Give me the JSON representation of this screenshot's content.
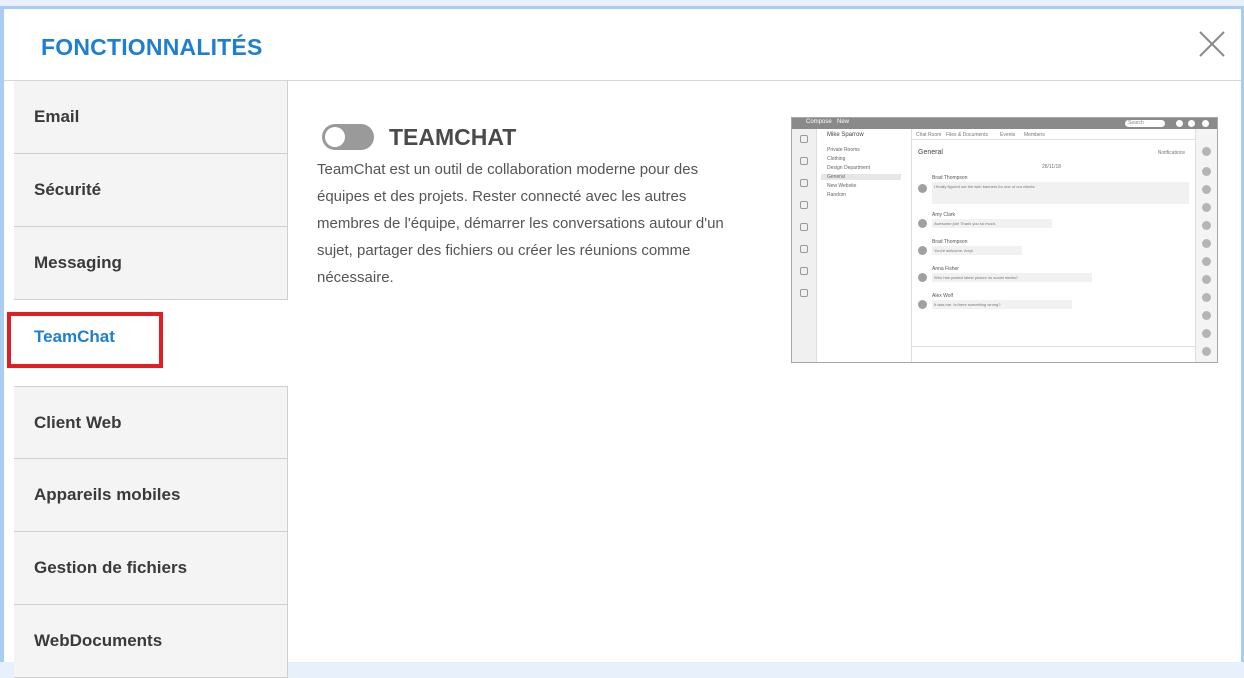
{
  "header": {
    "title": "FONCTIONNALITÉS"
  },
  "sidebar": {
    "items": [
      {
        "label": "Email",
        "active": false
      },
      {
        "label": "Sécurité",
        "active": false
      },
      {
        "label": "Messaging",
        "active": false
      },
      {
        "label": "TeamChat",
        "active": true
      },
      {
        "label": "Client Web",
        "active": false
      },
      {
        "label": "Appareils mobiles",
        "active": false
      },
      {
        "label": "Gestion de fichiers",
        "active": false
      },
      {
        "label": "WebDocuments",
        "active": false
      }
    ]
  },
  "feature": {
    "title": "TEAMCHAT",
    "enabled": false,
    "description": "TeamChat est un outil de collaboration moderne pour des équipes et des projets. Rester connecté avec les autres membres de l'équipe, démarrer les conversations autour d'un sujet, partager des fichiers ou créer les réunions comme nécessaire."
  },
  "screenshot": {
    "compose": "Compose",
    "new": "New",
    "search": "Search",
    "user": "Mike Sparrow",
    "rooms": [
      "Private Rooms",
      "Clothing",
      "Design Department",
      "General",
      "New Website",
      "Random"
    ],
    "tabs": [
      "Chat Room",
      "Files & Documents",
      "Events",
      "Members"
    ],
    "room_title": "General",
    "notifications": "Notifications",
    "date": "28/11/18",
    "messages": [
      {
        "author": "Brad Thompson",
        "text": "I finally figured out the web banners for one of our clients."
      },
      {
        "author": "Amy Clark",
        "text": "Awesome job! Thank you so much."
      },
      {
        "author": "Brad Thompson",
        "text": "You're welcome, Amy!"
      },
      {
        "author": "Anna Fisher",
        "text": "Who has posted latest picture on social media?"
      },
      {
        "author": "Alex Wolf",
        "text": "It was me. Is there something wrong?"
      }
    ]
  },
  "colors": {
    "accent": "#1e7fd2",
    "highlight": "#e01e24",
    "toggle_off": "#9a9a9a"
  }
}
